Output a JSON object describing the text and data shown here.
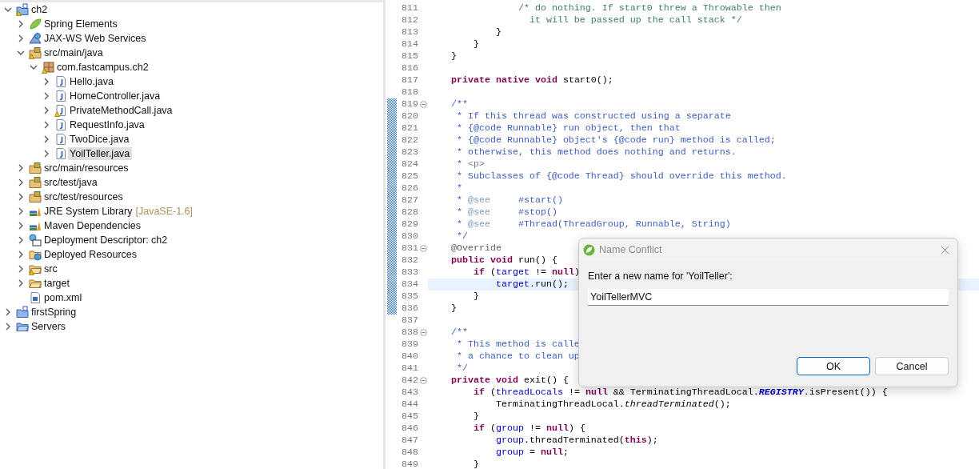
{
  "project_explorer": {
    "tree": [
      {
        "label": "ch2",
        "kind": "maven-project",
        "warning": true,
        "expanded": true,
        "selected": false,
        "children": [
          {
            "label": "Spring Elements",
            "kind": "spring",
            "warning": false,
            "expanded": false,
            "selected": false
          },
          {
            "label": "JAX-WS Web Services",
            "kind": "web-services",
            "warning": false,
            "expanded": false,
            "selected": false
          },
          {
            "label": "src/main/java",
            "kind": "source-folder",
            "warning": true,
            "expanded": true,
            "selected": false,
            "children": [
              {
                "label": "com.fastcampus.ch2",
                "kind": "package",
                "warning": true,
                "expanded": true,
                "selected": false,
                "children": [
                  {
                    "label": "Hello.java",
                    "kind": "java-file",
                    "warning": false,
                    "expanded": false,
                    "selected": false
                  },
                  {
                    "label": "HomeController.java",
                    "kind": "java-file",
                    "warning": false,
                    "expanded": false,
                    "selected": false
                  },
                  {
                    "label": "PrivateMethodCall.java",
                    "kind": "java-file",
                    "warning": true,
                    "expanded": false,
                    "selected": false
                  },
                  {
                    "label": "RequestInfo.java",
                    "kind": "java-file",
                    "warning": false,
                    "expanded": false,
                    "selected": false
                  },
                  {
                    "label": "TwoDice.java",
                    "kind": "java-file",
                    "warning": false,
                    "expanded": false,
                    "selected": false
                  },
                  {
                    "label": "YoilTeller.java",
                    "kind": "java-file",
                    "warning": false,
                    "expanded": false,
                    "selected": true
                  }
                ]
              }
            ]
          },
          {
            "label": "src/main/resources",
            "kind": "source-folder",
            "warning": false,
            "expanded": false,
            "selected": false
          },
          {
            "label": "src/test/java",
            "kind": "source-folder",
            "warning": false,
            "expanded": false,
            "selected": false
          },
          {
            "label": "src/test/resources",
            "kind": "source-folder",
            "warning": false,
            "expanded": false,
            "selected": false
          },
          {
            "label": "JRE System Library",
            "version": "[JavaSE-1.6]",
            "kind": "library",
            "warning": false,
            "expanded": false,
            "selected": false
          },
          {
            "label": "Maven Dependencies",
            "kind": "library",
            "warning": false,
            "expanded": false,
            "selected": false
          },
          {
            "label": "Deployment Descriptor: ch2",
            "kind": "descriptor",
            "warning": false,
            "expanded": false,
            "selected": false
          },
          {
            "label": "Deployed Resources",
            "kind": "deployed",
            "warning": false,
            "expanded": false,
            "selected": false
          },
          {
            "label": "src",
            "kind": "folder",
            "warning": true,
            "expanded": false,
            "selected": false
          },
          {
            "label": "target",
            "kind": "folder",
            "warning": false,
            "expanded": false,
            "selected": false
          },
          {
            "label": "pom.xml",
            "kind": "xml-file",
            "warning": false,
            "selected": false
          }
        ]
      },
      {
        "label": "firstSpring",
        "kind": "maven-project",
        "warning": false,
        "expanded": false,
        "selected": false
      },
      {
        "label": "Servers",
        "kind": "servers-folder",
        "warning": false,
        "expanded": false,
        "selected": false
      }
    ]
  },
  "editor": {
    "lines": [
      {
        "number": "811",
        "fold": false,
        "current": false,
        "in_range": false,
        "tokens": [
          {
            "kind": "comment",
            "text": "                /* do nothing. If start0 threw a Throwable then"
          }
        ]
      },
      {
        "number": "812",
        "fold": false,
        "current": false,
        "in_range": false,
        "tokens": [
          {
            "kind": "comment",
            "text": "                  it will be passed up the call stack */"
          }
        ]
      },
      {
        "number": "813",
        "fold": false,
        "current": false,
        "in_range": false,
        "tokens": [
          {
            "kind": "plain",
            "text": "            }"
          }
        ]
      },
      {
        "number": "814",
        "fold": false,
        "current": false,
        "in_range": false,
        "tokens": [
          {
            "kind": "plain",
            "text": "        }"
          }
        ]
      },
      {
        "number": "815",
        "fold": false,
        "current": false,
        "in_range": false,
        "tokens": [
          {
            "kind": "plain",
            "text": "    }"
          }
        ]
      },
      {
        "number": "816",
        "fold": false,
        "current": false,
        "in_range": false
      },
      {
        "number": "817",
        "fold": false,
        "current": false,
        "in_range": false,
        "tokens": [
          {
            "kind": "keyword",
            "text": "    private native void"
          },
          {
            "kind": "plain",
            "text": " start0();"
          }
        ]
      },
      {
        "number": "818",
        "fold": false,
        "current": false,
        "in_range": false
      },
      {
        "number": "819",
        "fold": true,
        "current": false,
        "in_range": true,
        "tokens": [
          {
            "kind": "javadoc",
            "text": "    /**"
          }
        ]
      },
      {
        "number": "820",
        "fold": false,
        "current": false,
        "in_range": true,
        "tokens": [
          {
            "kind": "javadoc",
            "text": "     * If this thread was constructed using a separate"
          }
        ]
      },
      {
        "number": "821",
        "fold": false,
        "current": false,
        "in_range": true,
        "tokens": [
          {
            "kind": "javadoc",
            "text": "     * {@code Runnable} run object, then that"
          }
        ]
      },
      {
        "number": "822",
        "fold": false,
        "current": false,
        "in_range": true,
        "tokens": [
          {
            "kind": "javadoc",
            "text": "     * {@code Runnable} object's {@code run} method is called;"
          }
        ]
      },
      {
        "number": "823",
        "fold": false,
        "current": false,
        "in_range": true,
        "tokens": [
          {
            "kind": "javadoc",
            "text": "     * otherwise, this method does nothing and returns."
          }
        ]
      },
      {
        "number": "824",
        "fold": false,
        "current": false,
        "in_range": true,
        "tokens": [
          {
            "kind": "javadoc",
            "text": "     * "
          },
          {
            "kind": "html",
            "text": "<p>"
          }
        ]
      },
      {
        "number": "825",
        "fold": false,
        "current": false,
        "in_range": true,
        "tokens": [
          {
            "kind": "javadoc",
            "text": "     * Subclasses of {@code Thread} should override this method."
          }
        ]
      },
      {
        "number": "826",
        "fold": false,
        "current": false,
        "in_range": true,
        "tokens": [
          {
            "kind": "javadoc",
            "text": "     *"
          }
        ]
      },
      {
        "number": "827",
        "fold": false,
        "current": false,
        "in_range": true,
        "tokens": [
          {
            "kind": "javadoc",
            "text": "     * "
          },
          {
            "kind": "tag",
            "text": "@see"
          },
          {
            "kind": "javadoc",
            "text": "     #start()"
          }
        ]
      },
      {
        "number": "828",
        "fold": false,
        "current": false,
        "in_range": true,
        "tokens": [
          {
            "kind": "javadoc",
            "text": "     * "
          },
          {
            "kind": "tag",
            "text": "@see"
          },
          {
            "kind": "javadoc",
            "text": "     #stop()"
          }
        ]
      },
      {
        "number": "829",
        "fold": false,
        "current": false,
        "in_range": true,
        "tokens": [
          {
            "kind": "javadoc",
            "text": "     * "
          },
          {
            "kind": "tag",
            "text": "@see"
          },
          {
            "kind": "javadoc",
            "text": "     #Thread(ThreadGroup, Runnable, String)"
          }
        ]
      },
      {
        "number": "830",
        "fold": false,
        "current": false,
        "in_range": true,
        "tokens": [
          {
            "kind": "javadoc",
            "text": "     */"
          }
        ]
      },
      {
        "number": "831",
        "fold": true,
        "current": false,
        "in_range": true,
        "tokens": [
          {
            "kind": "annotation",
            "text": "    @Override"
          }
        ]
      },
      {
        "number": "832",
        "fold": false,
        "current": false,
        "in_range": true,
        "tokens": [
          {
            "kind": "keyword",
            "text": "    public void"
          },
          {
            "kind": "plain",
            "text": " run() {"
          }
        ]
      },
      {
        "number": "833",
        "fold": false,
        "current": false,
        "in_range": true,
        "tokens": [
          {
            "kind": "keyword",
            "text": "        if"
          },
          {
            "kind": "plain",
            "text": " ("
          },
          {
            "kind": "field",
            "text": "target"
          },
          {
            "kind": "plain",
            "text": " != "
          },
          {
            "kind": "keyword",
            "text": "null"
          },
          {
            "kind": "plain",
            "text": ")"
          }
        ]
      },
      {
        "number": "834",
        "fold": false,
        "current": true,
        "in_range": true,
        "tokens": [
          {
            "kind": "field",
            "text": "            target"
          },
          {
            "kind": "plain",
            "text": ".run();"
          }
        ]
      },
      {
        "number": "835",
        "fold": false,
        "current": false,
        "in_range": true,
        "tokens": [
          {
            "kind": "plain",
            "text": "        }"
          }
        ]
      },
      {
        "number": "836",
        "fold": false,
        "current": false,
        "in_range": true,
        "tokens": [
          {
            "kind": "plain",
            "text": "    }"
          }
        ]
      },
      {
        "number": "837",
        "fold": false,
        "current": false,
        "in_range": false
      },
      {
        "number": "838",
        "fold": true,
        "current": false,
        "in_range": false,
        "tokens": [
          {
            "kind": "javadoc",
            "text": "    /**"
          }
        ]
      },
      {
        "number": "839",
        "fold": false,
        "current": false,
        "in_range": false,
        "tokens": [
          {
            "kind": "javadoc",
            "text": "     * This method is calle"
          }
        ]
      },
      {
        "number": "840",
        "fold": false,
        "current": false,
        "in_range": false,
        "tokens": [
          {
            "kind": "javadoc",
            "text": "     * a chance to clean up"
          }
        ]
      },
      {
        "number": "841",
        "fold": false,
        "current": false,
        "in_range": false,
        "tokens": [
          {
            "kind": "javadoc",
            "text": "     */"
          }
        ]
      },
      {
        "number": "842",
        "fold": true,
        "current": false,
        "in_range": false,
        "tokens": [
          {
            "kind": "keyword",
            "text": "    private void"
          },
          {
            "kind": "plain",
            "text": " exit() {"
          }
        ]
      },
      {
        "number": "843",
        "fold": false,
        "current": false,
        "in_range": false,
        "tokens": [
          {
            "kind": "keyword",
            "text": "        if"
          },
          {
            "kind": "plain",
            "text": " ("
          },
          {
            "kind": "field",
            "text": "threadLocals"
          },
          {
            "kind": "plain",
            "text": " != "
          },
          {
            "kind": "keyword",
            "text": "null"
          },
          {
            "kind": "plain",
            "text": " && TerminatingThreadLocal."
          },
          {
            "kind": "static-field",
            "text": "REGISTRY"
          },
          {
            "kind": "plain",
            "text": ".isPresent()) {"
          }
        ]
      },
      {
        "number": "844",
        "fold": false,
        "current": false,
        "in_range": false,
        "tokens": [
          {
            "kind": "plain",
            "text": "            TerminatingThreadLocal."
          },
          {
            "kind": "static-method",
            "text": "threadTerminated"
          },
          {
            "kind": "plain",
            "text": "();"
          }
        ]
      },
      {
        "number": "845",
        "fold": false,
        "current": false,
        "in_range": false,
        "tokens": [
          {
            "kind": "plain",
            "text": "        }"
          }
        ]
      },
      {
        "number": "846",
        "fold": false,
        "current": false,
        "in_range": false,
        "tokens": [
          {
            "kind": "keyword",
            "text": "        if"
          },
          {
            "kind": "plain",
            "text": " ("
          },
          {
            "kind": "field",
            "text": "group"
          },
          {
            "kind": "plain",
            "text": " != "
          },
          {
            "kind": "keyword",
            "text": "null"
          },
          {
            "kind": "plain",
            "text": ") {"
          }
        ]
      },
      {
        "number": "847",
        "fold": false,
        "current": false,
        "in_range": false,
        "tokens": [
          {
            "kind": "field",
            "text": "            group"
          },
          {
            "kind": "plain",
            "text": ".threadTerminated("
          },
          {
            "kind": "keyword",
            "text": "this"
          },
          {
            "kind": "plain",
            "text": ");"
          }
        ]
      },
      {
        "number": "848",
        "fold": false,
        "current": false,
        "in_range": false,
        "tokens": [
          {
            "kind": "field",
            "text": "            group"
          },
          {
            "kind": "plain",
            "text": " = "
          },
          {
            "kind": "keyword",
            "text": "null"
          },
          {
            "kind": "plain",
            "text": ";"
          }
        ]
      },
      {
        "number": "849",
        "fold": false,
        "current": false,
        "in_range": false,
        "tokens": [
          {
            "kind": "plain",
            "text": "        }"
          }
        ]
      }
    ]
  },
  "dialog": {
    "title": "Name Conflict",
    "prompt": "Enter a new name for 'YoilTeller':",
    "value": "YoilTellerMVC",
    "buttons": [
      {
        "label": "OK",
        "default": true
      },
      {
        "label": "Cancel",
        "default": false
      }
    ]
  }
}
